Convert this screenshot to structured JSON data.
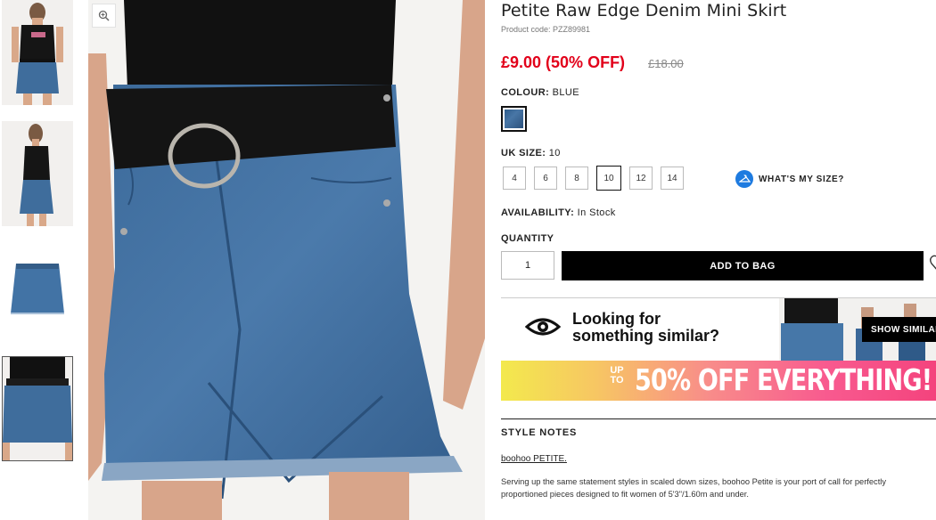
{
  "product": {
    "title": "Petite Raw Edge Denim Mini Skirt",
    "code": "Product code: PZZ89981",
    "price": "£9.00 (50% OFF)",
    "was_price": "£18.00"
  },
  "colour": {
    "label": "COLOUR:",
    "value": "BLUE",
    "swatch_color": "#3a6796"
  },
  "size": {
    "label": "UK SIZE:",
    "value": "10",
    "options": [
      "4",
      "6",
      "8",
      "10",
      "12",
      "14"
    ],
    "selected": "10",
    "whats_my_size": "WHAT'S MY SIZE?"
  },
  "availability": {
    "label": "AVAILABILITY:",
    "value": "In Stock"
  },
  "quantity": {
    "label": "QUANTITY",
    "value": "1"
  },
  "add_to_bag": "ADD TO BAG",
  "similar": {
    "line1": "Looking for",
    "line2": "something similar?",
    "button": "SHOW SIMILAR"
  },
  "banner": {
    "upto": "UP TO",
    "text": "50% OFF EVERYTHING!"
  },
  "style_notes": {
    "title": "STYLE NOTES",
    "subtitle": "boohoo PETITE.",
    "body": "Serving up the same statement styles in scaled down sizes, boohoo Petite is your port of call for perfectly proportioned pieces designed to fit women of 5'3\"/1.60m and under."
  },
  "icons": {
    "zoom": "zoom-icon",
    "eye": "eye-icon",
    "hanger": "hanger-icon",
    "heart": "heart-icon"
  },
  "colors": {
    "sale_red": "#e2001a",
    "accent_blue": "#1e7be0",
    "black": "#000000"
  }
}
